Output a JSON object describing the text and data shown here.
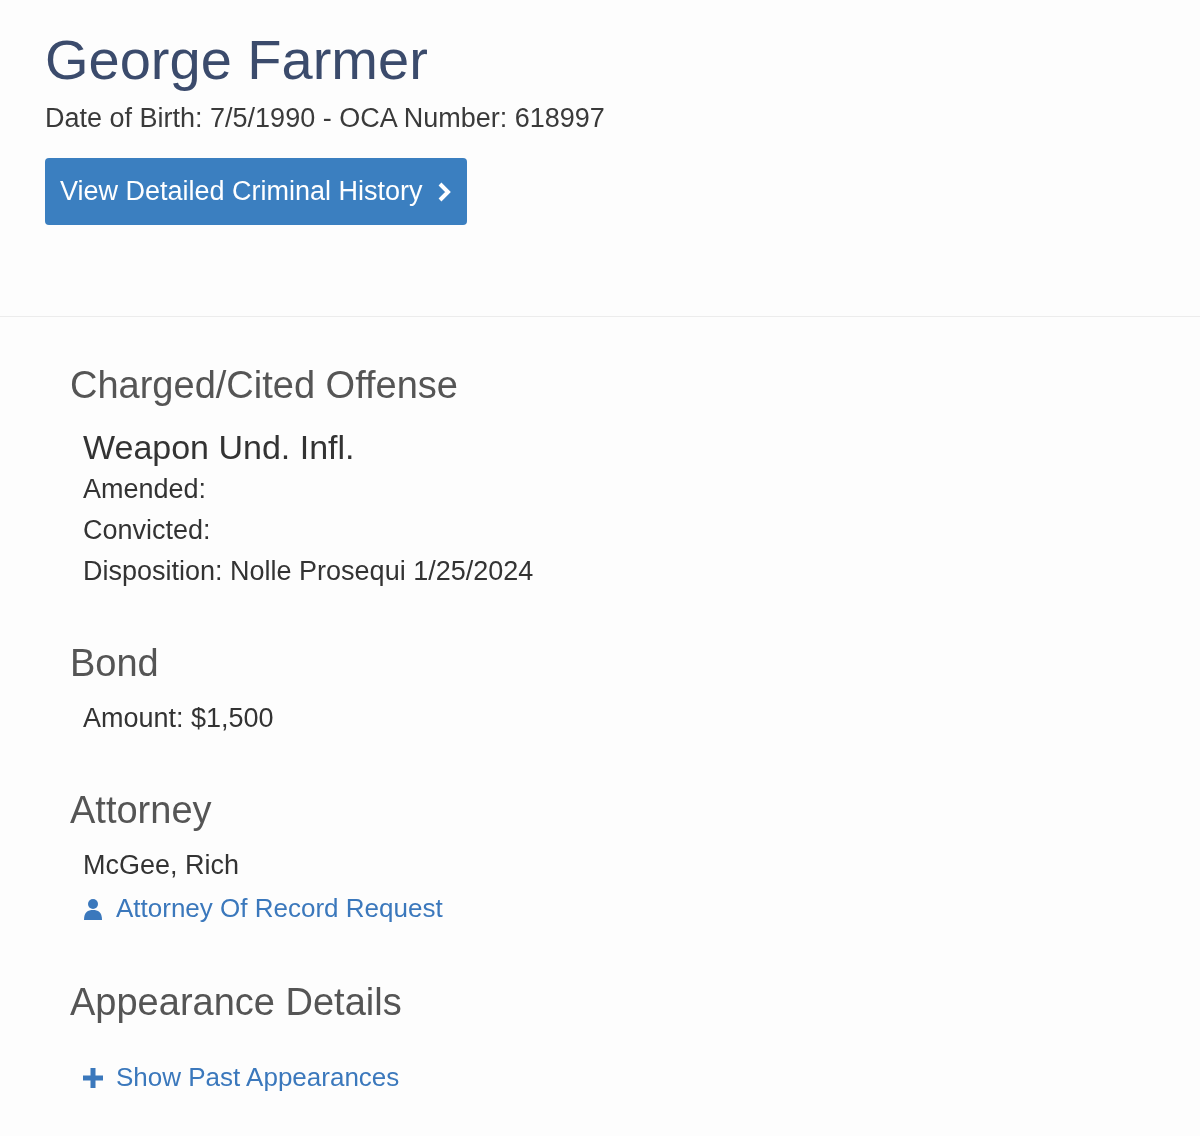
{
  "person": {
    "name": "George Farmer",
    "details": "Date of Birth: 7/5/1990 - OCA Number: 618997"
  },
  "history_button": {
    "label": "View Detailed Criminal History"
  },
  "sections": [
    {
      "title": "Charged/Cited Offense",
      "items": [
        {
          "kind": "heading",
          "text": "Weapon Und. Infl."
        },
        {
          "kind": "line",
          "text": "Amended:"
        },
        {
          "kind": "line",
          "text": "Convicted:"
        },
        {
          "kind": "line",
          "text": "Disposition: Nolle Prosequi 1/25/2024"
        }
      ]
    },
    {
      "title": "Bond",
      "items": [
        {
          "kind": "line",
          "text": "Amount: $1,500"
        }
      ]
    },
    {
      "title": "Attorney",
      "items": [
        {
          "kind": "line",
          "text": "McGee, Rich"
        },
        {
          "kind": "request",
          "text": "Attorney Of Record Request"
        }
      ]
    },
    {
      "title": "Appearance Details",
      "items": [
        {
          "kind": "expander",
          "text": "Show Past Appearances"
        }
      ]
    }
  ]
}
